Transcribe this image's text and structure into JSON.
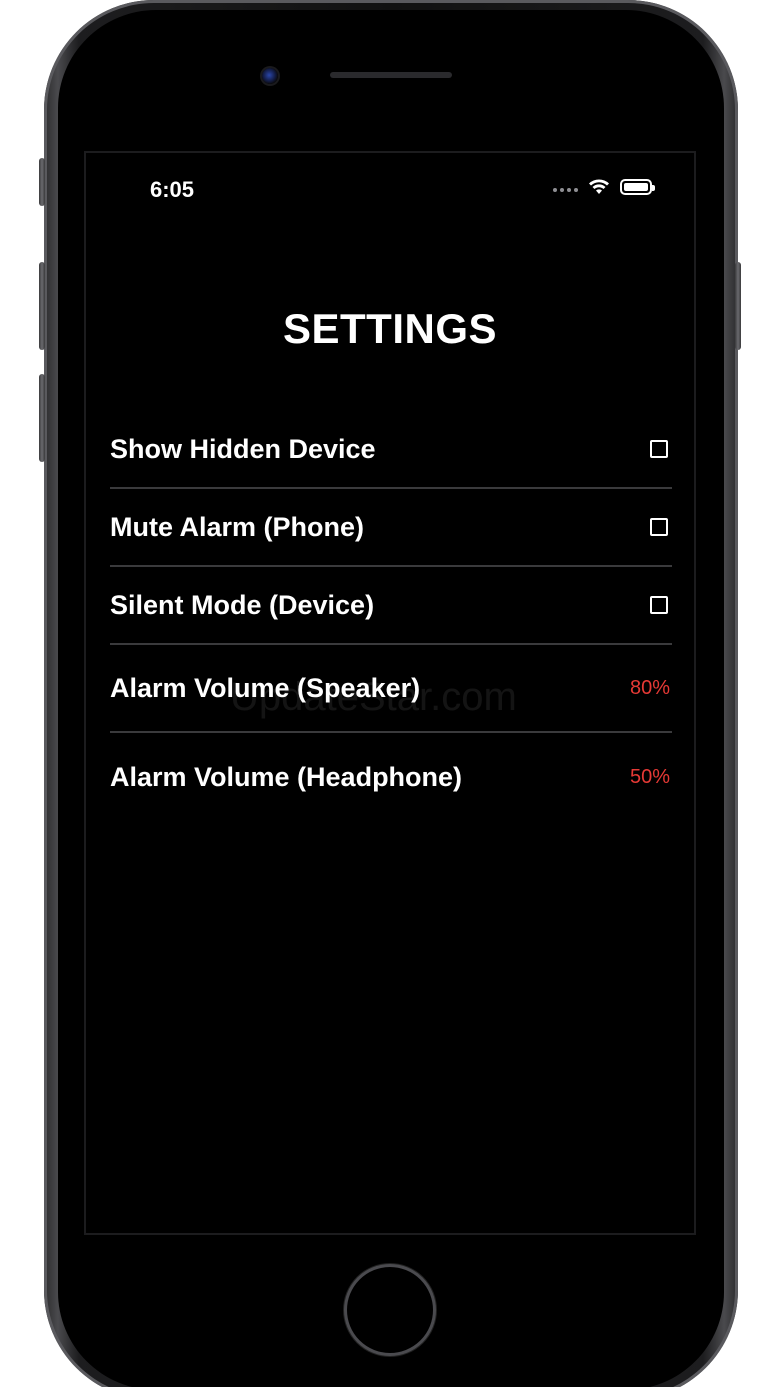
{
  "status_bar": {
    "time": "6:05",
    "icons": [
      "cellular-signal-icon",
      "wifi-icon",
      "battery-icon"
    ]
  },
  "page": {
    "title": "SETTINGS"
  },
  "settings": [
    {
      "label": "Show Hidden Device",
      "control": "checkbox",
      "checked": false
    },
    {
      "label": "Mute Alarm (Phone)",
      "control": "checkbox",
      "checked": false
    },
    {
      "label": "Silent Mode (Device)",
      "control": "checkbox",
      "checked": false
    },
    {
      "label": "Alarm Volume (Speaker)",
      "control": "value",
      "value": "80%"
    },
    {
      "label": "Alarm Volume (Headphone)",
      "control": "value",
      "value": "50%"
    }
  ],
  "watermark": "UpdateStar.com",
  "colors": {
    "background": "#000000",
    "text": "#ffffff",
    "accent_value": "#e53935",
    "divider": "#3a3a3c"
  }
}
